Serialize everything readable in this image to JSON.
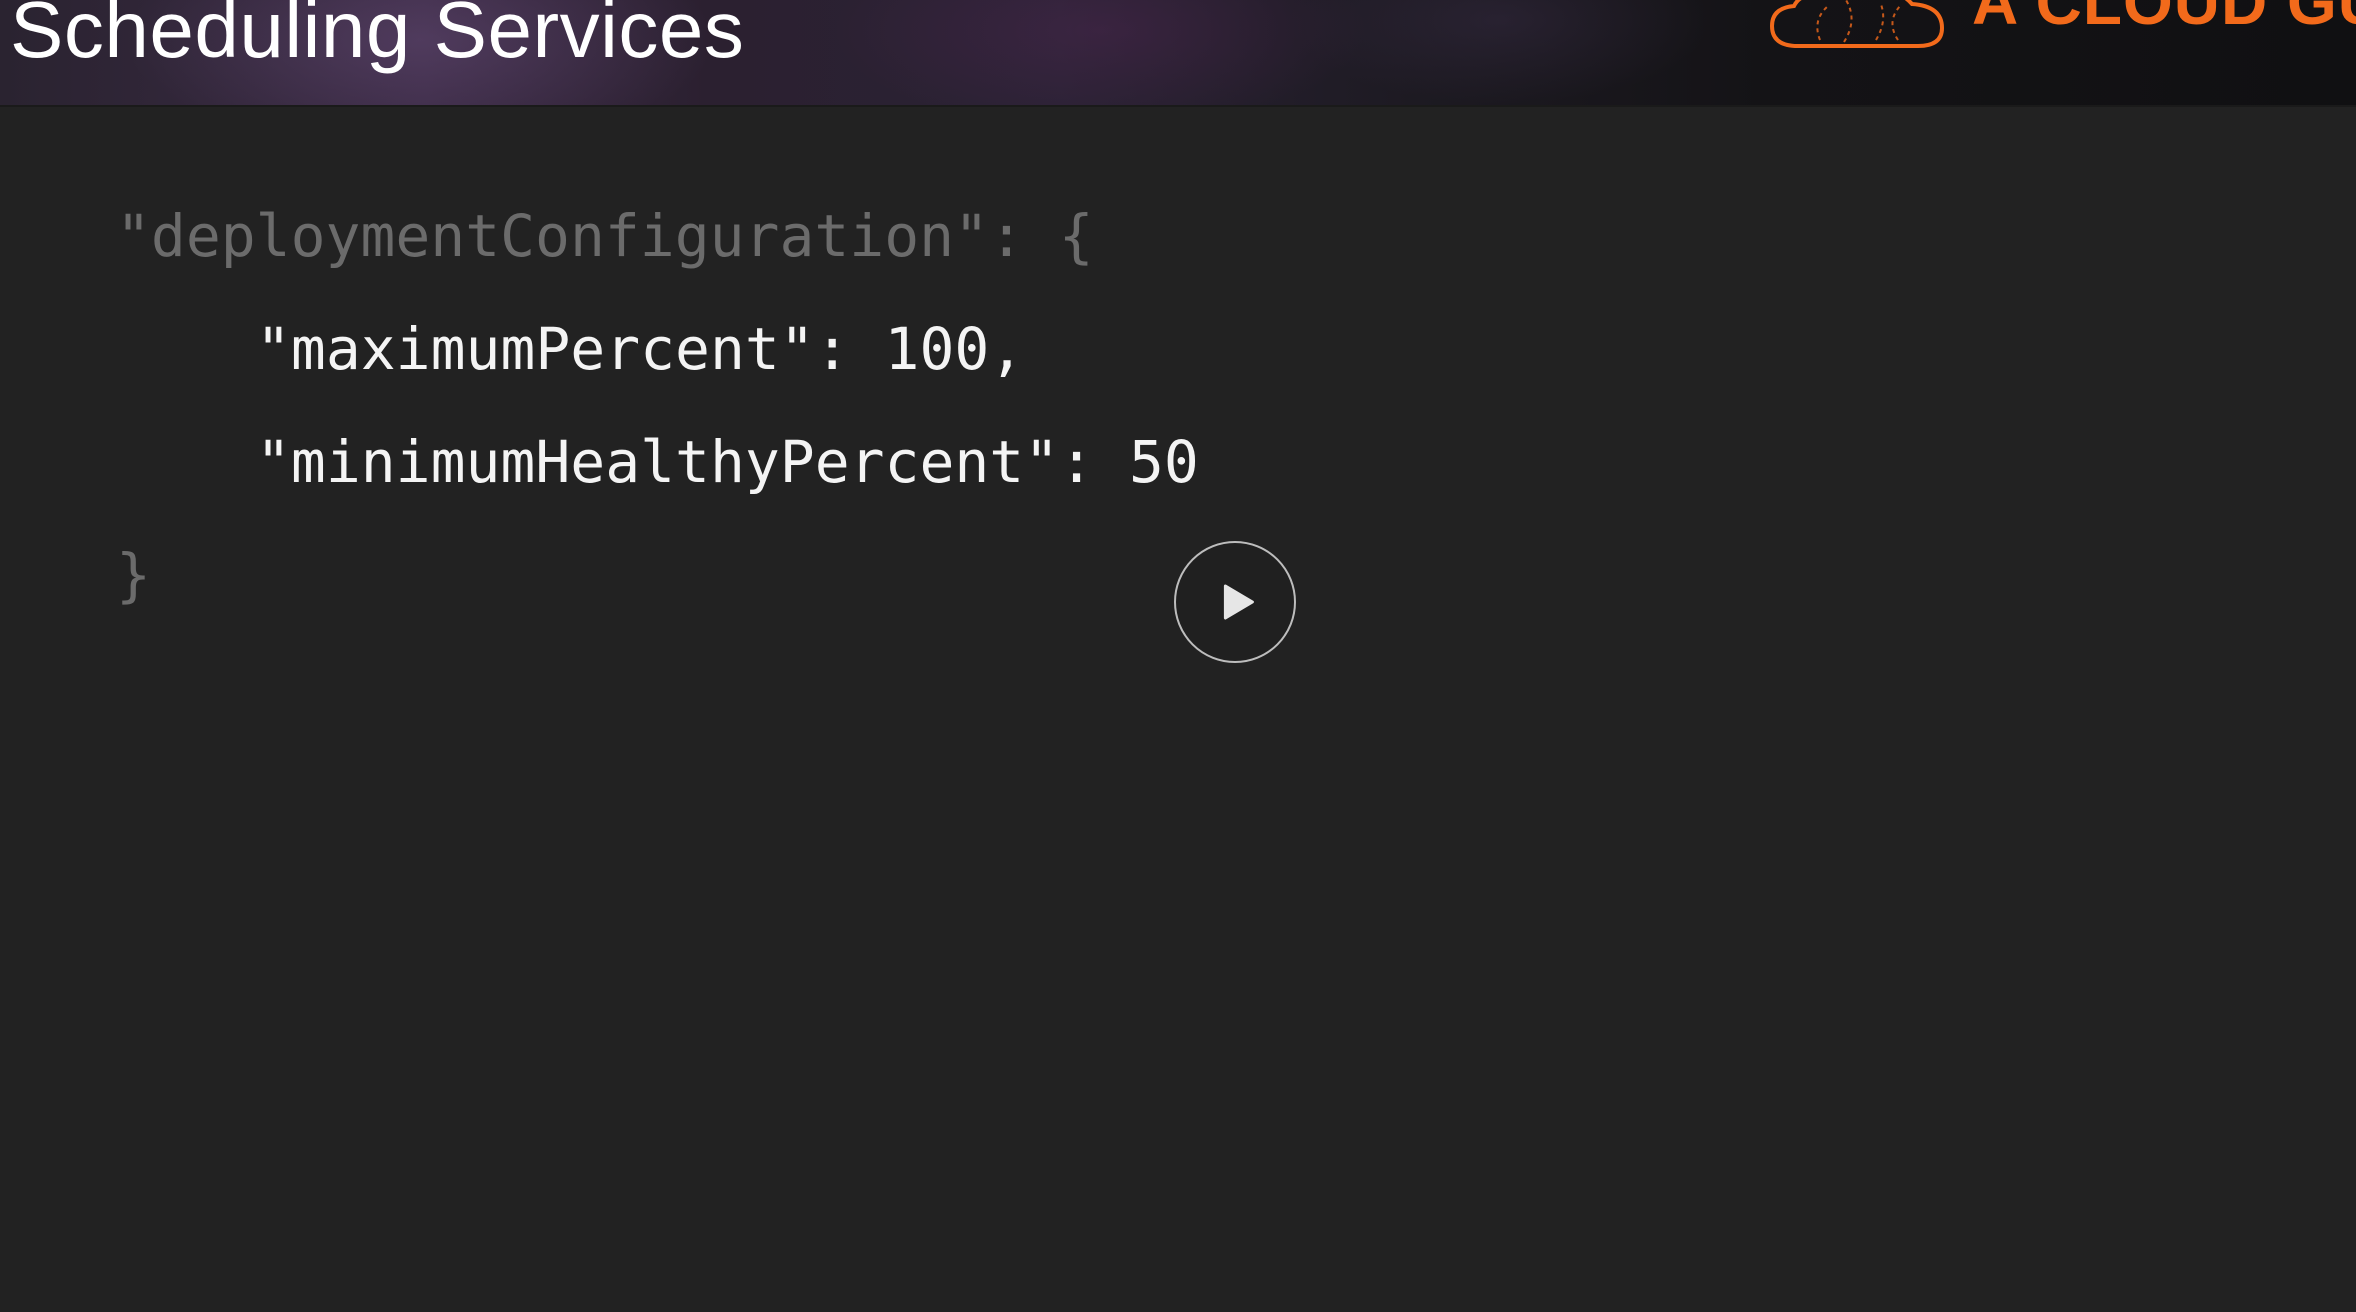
{
  "slide": {
    "title": "Scheduling Services"
  },
  "brand": {
    "name": "A CLOUD GU",
    "logo_icon": "cloud-logo-icon",
    "accent_color": "#f26a1b"
  },
  "code": {
    "lines": [
      "\"deploymentConfiguration\": {",
      "\"maximumPercent\": 100,",
      "\"minimumHealthyPercent\": 50",
      "}"
    ]
  },
  "player": {
    "play_icon": "play-icon"
  },
  "colors": {
    "background": "#222222",
    "dim_code": "#6b6b6b",
    "bright_code": "#f4f4f4"
  }
}
